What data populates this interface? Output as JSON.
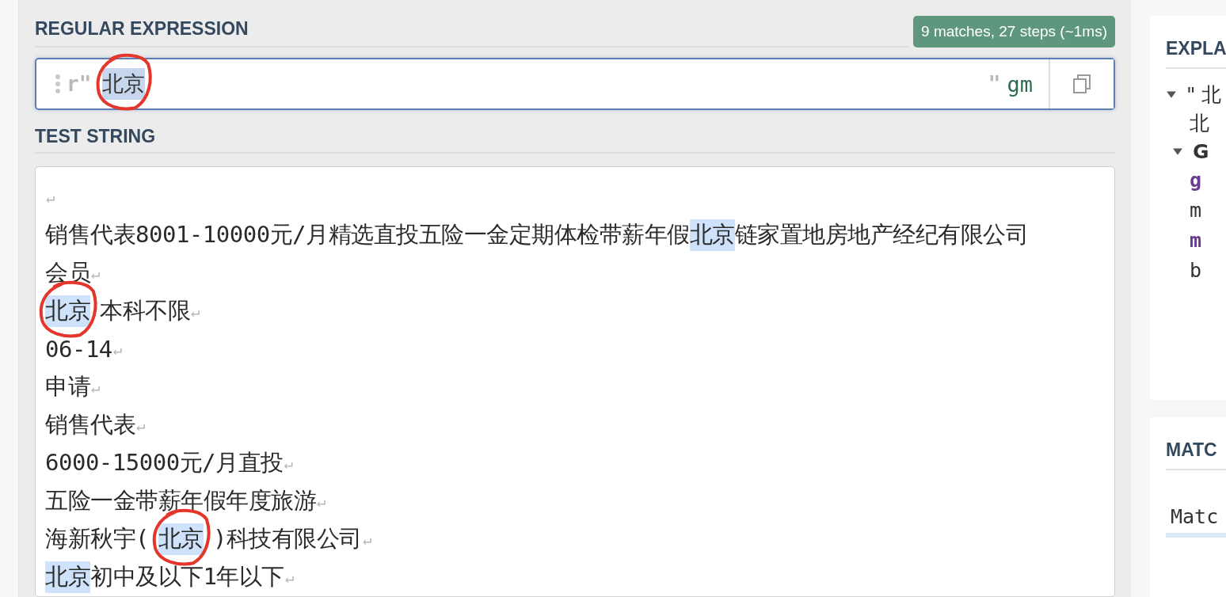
{
  "regex_panel": {
    "title": "REGULAR EXPRESSION",
    "result_badge": "9 matches, 27 steps (~1ms)",
    "prefix": "r\"",
    "pattern": {
      "text": "北京",
      "selected": true,
      "circled": true
    },
    "suffix": "\"",
    "flags": "gm"
  },
  "test_string": {
    "title": "TEST STRING",
    "lines": [
      {
        "end_mark": "↵"
      },
      {
        "segments": [
          {
            "text": "销售代表8001-10000元/月精选直投五险一金定期体检带薪年假",
            "match": false,
            "circled": false
          },
          {
            "text": "北京",
            "match": true,
            "circled": false
          },
          {
            "text": "链家置地房地产经纪有限公司",
            "match": false,
            "circled": false
          }
        ]
      },
      {
        "segments": [
          {
            "text": "会员",
            "match": false,
            "circled": false
          }
        ],
        "end_mark": "↵"
      },
      {
        "segments": [
          {
            "text": "北京",
            "match": true,
            "circled": true
          },
          {
            "text": "本科不限",
            "match": false,
            "circled": false
          }
        ],
        "end_mark": "↵"
      },
      {
        "segments": [
          {
            "text": "06-14",
            "match": false,
            "circled": false
          }
        ],
        "end_mark": "↵"
      },
      {
        "segments": [
          {
            "text": "申请",
            "match": false,
            "circled": false
          }
        ],
        "end_mark": "↵"
      },
      {
        "segments": [
          {
            "text": "销售代表",
            "match": false,
            "circled": false
          }
        ],
        "end_mark": "↵"
      },
      {
        "segments": [
          {
            "text": "6000-15000元/月直投",
            "match": false,
            "circled": false
          }
        ],
        "end_mark": "↵"
      },
      {
        "segments": [
          {
            "text": "五险一金带薪年假年度旅游",
            "match": false,
            "circled": false
          }
        ],
        "end_mark": "↵"
      },
      {
        "segments": [
          {
            "text": "海新秋宇(",
            "match": false,
            "circled": false
          },
          {
            "text": "北京",
            "match": true,
            "circled": true
          },
          {
            "text": ")科技有限公司",
            "match": false,
            "circled": false
          }
        ],
        "end_mark": "↵"
      },
      {
        "segments": [
          {
            "text": "北京",
            "match": true,
            "circled": false
          },
          {
            "text": "初中及以下1年以下",
            "match": false,
            "circled": false
          }
        ],
        "end_mark": "↵"
      }
    ]
  },
  "explanation": {
    "title": "EXPLA",
    "tree": [
      {
        "label": [
          "\" 北",
          "北"
        ],
        "bold": false,
        "expanded": true,
        "children": [
          {
            "label": [
              "G"
            ],
            "bold": true,
            "expanded": true,
            "lines": [
              {
                "text": "g",
                "kind": "token"
              },
              {
                "text": "m",
                "kind": "plain"
              },
              {
                "text": "m",
                "kind": "token"
              },
              {
                "text": "b",
                "kind": "plain"
              }
            ]
          }
        ]
      }
    ]
  },
  "match_info": {
    "title": "MATC",
    "rows": [
      {
        "text": "Matc",
        "selected": true
      }
    ]
  }
}
